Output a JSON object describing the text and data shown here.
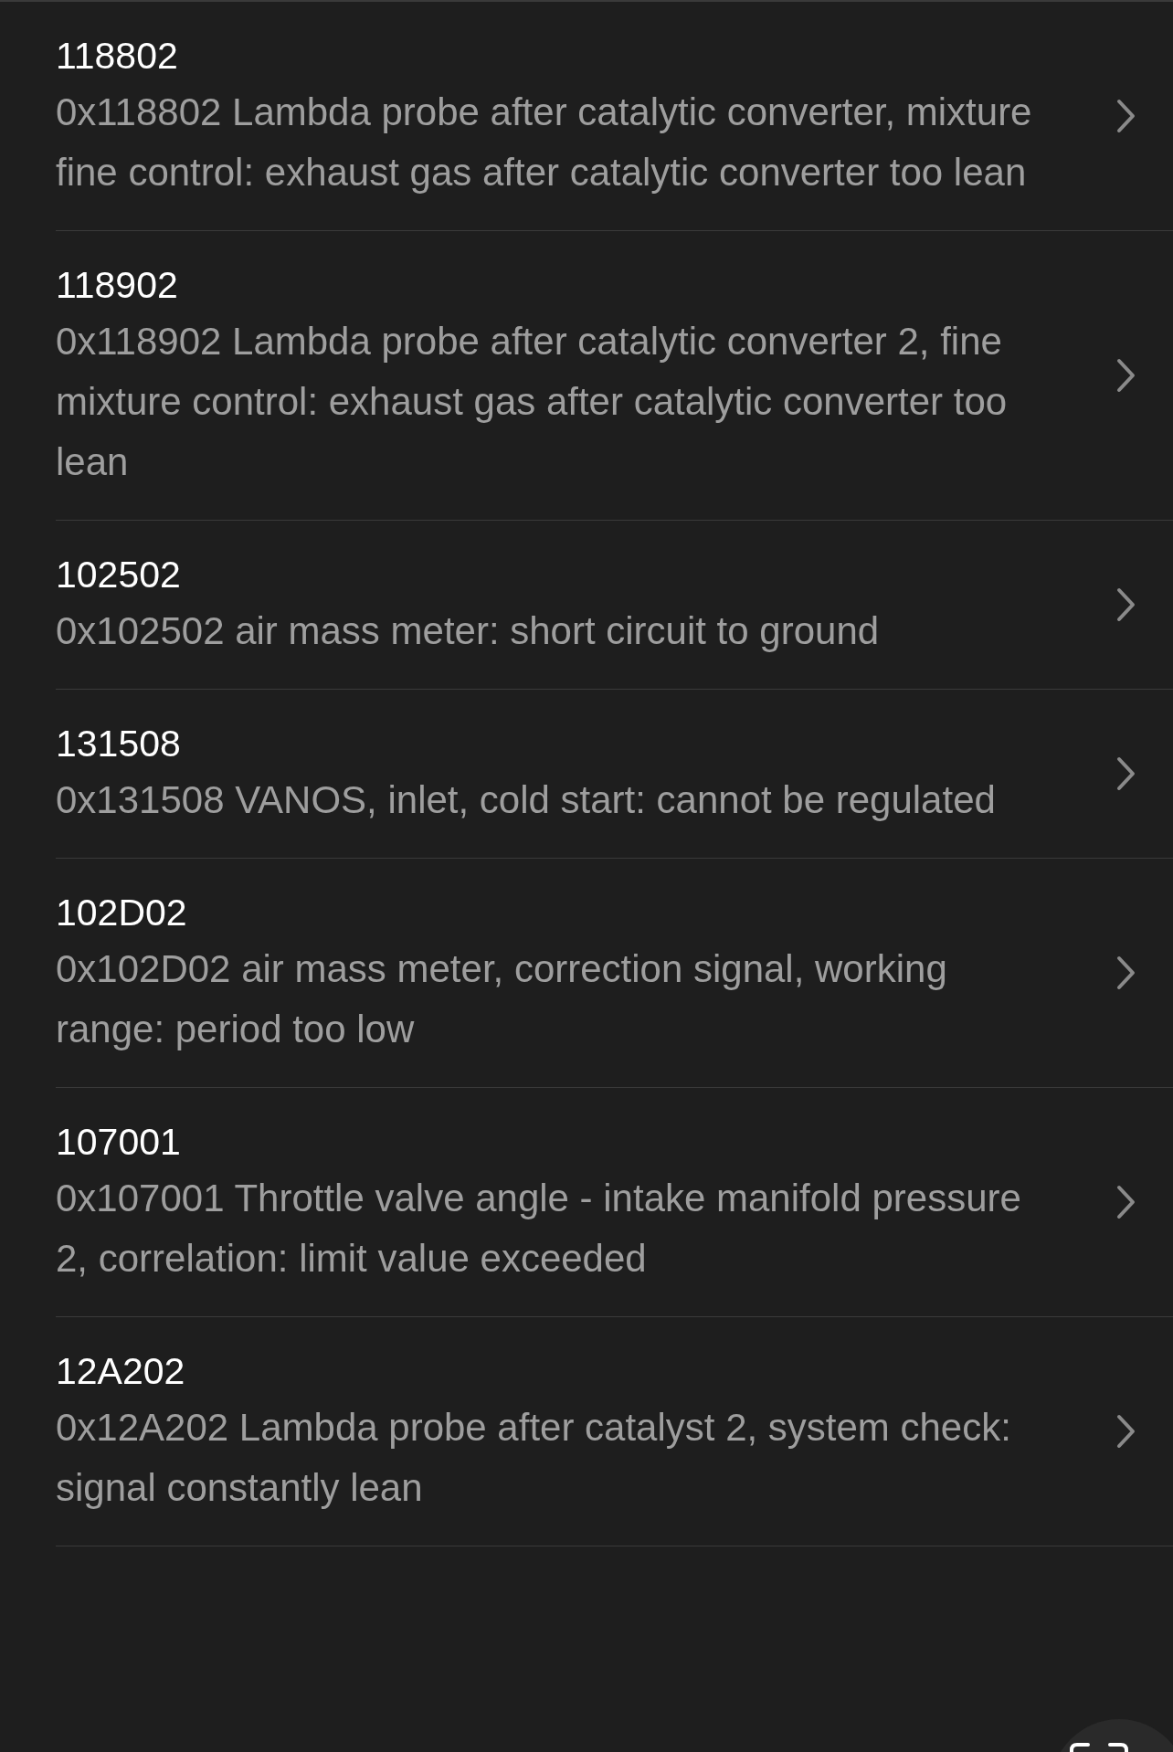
{
  "faults": [
    {
      "code": "118802",
      "description": "0x118802 Lambda probe after catalytic converter, mixture fine control: exhaust gas after catalytic converter too lean"
    },
    {
      "code": "118902",
      "description": "0x118902 Lambda probe after catalytic converter 2, fine mixture control: exhaust gas after catalytic converter too lean"
    },
    {
      "code": "102502",
      "description": "0x102502 air mass meter: short circuit to ground"
    },
    {
      "code": "131508",
      "description": "0x131508 VANOS, inlet, cold start: cannot be regulated"
    },
    {
      "code": "102D02",
      "description": "0x102D02 air mass meter, correction signal, working range: period too low"
    },
    {
      "code": "107001",
      "description": "0x107001 Throttle valve angle - intake manifold pressure 2, correlation: limit value exceeded"
    },
    {
      "code": "12A202",
      "description": "0x12A202 Lambda probe after catalyst 2, system check: signal constantly lean"
    }
  ]
}
